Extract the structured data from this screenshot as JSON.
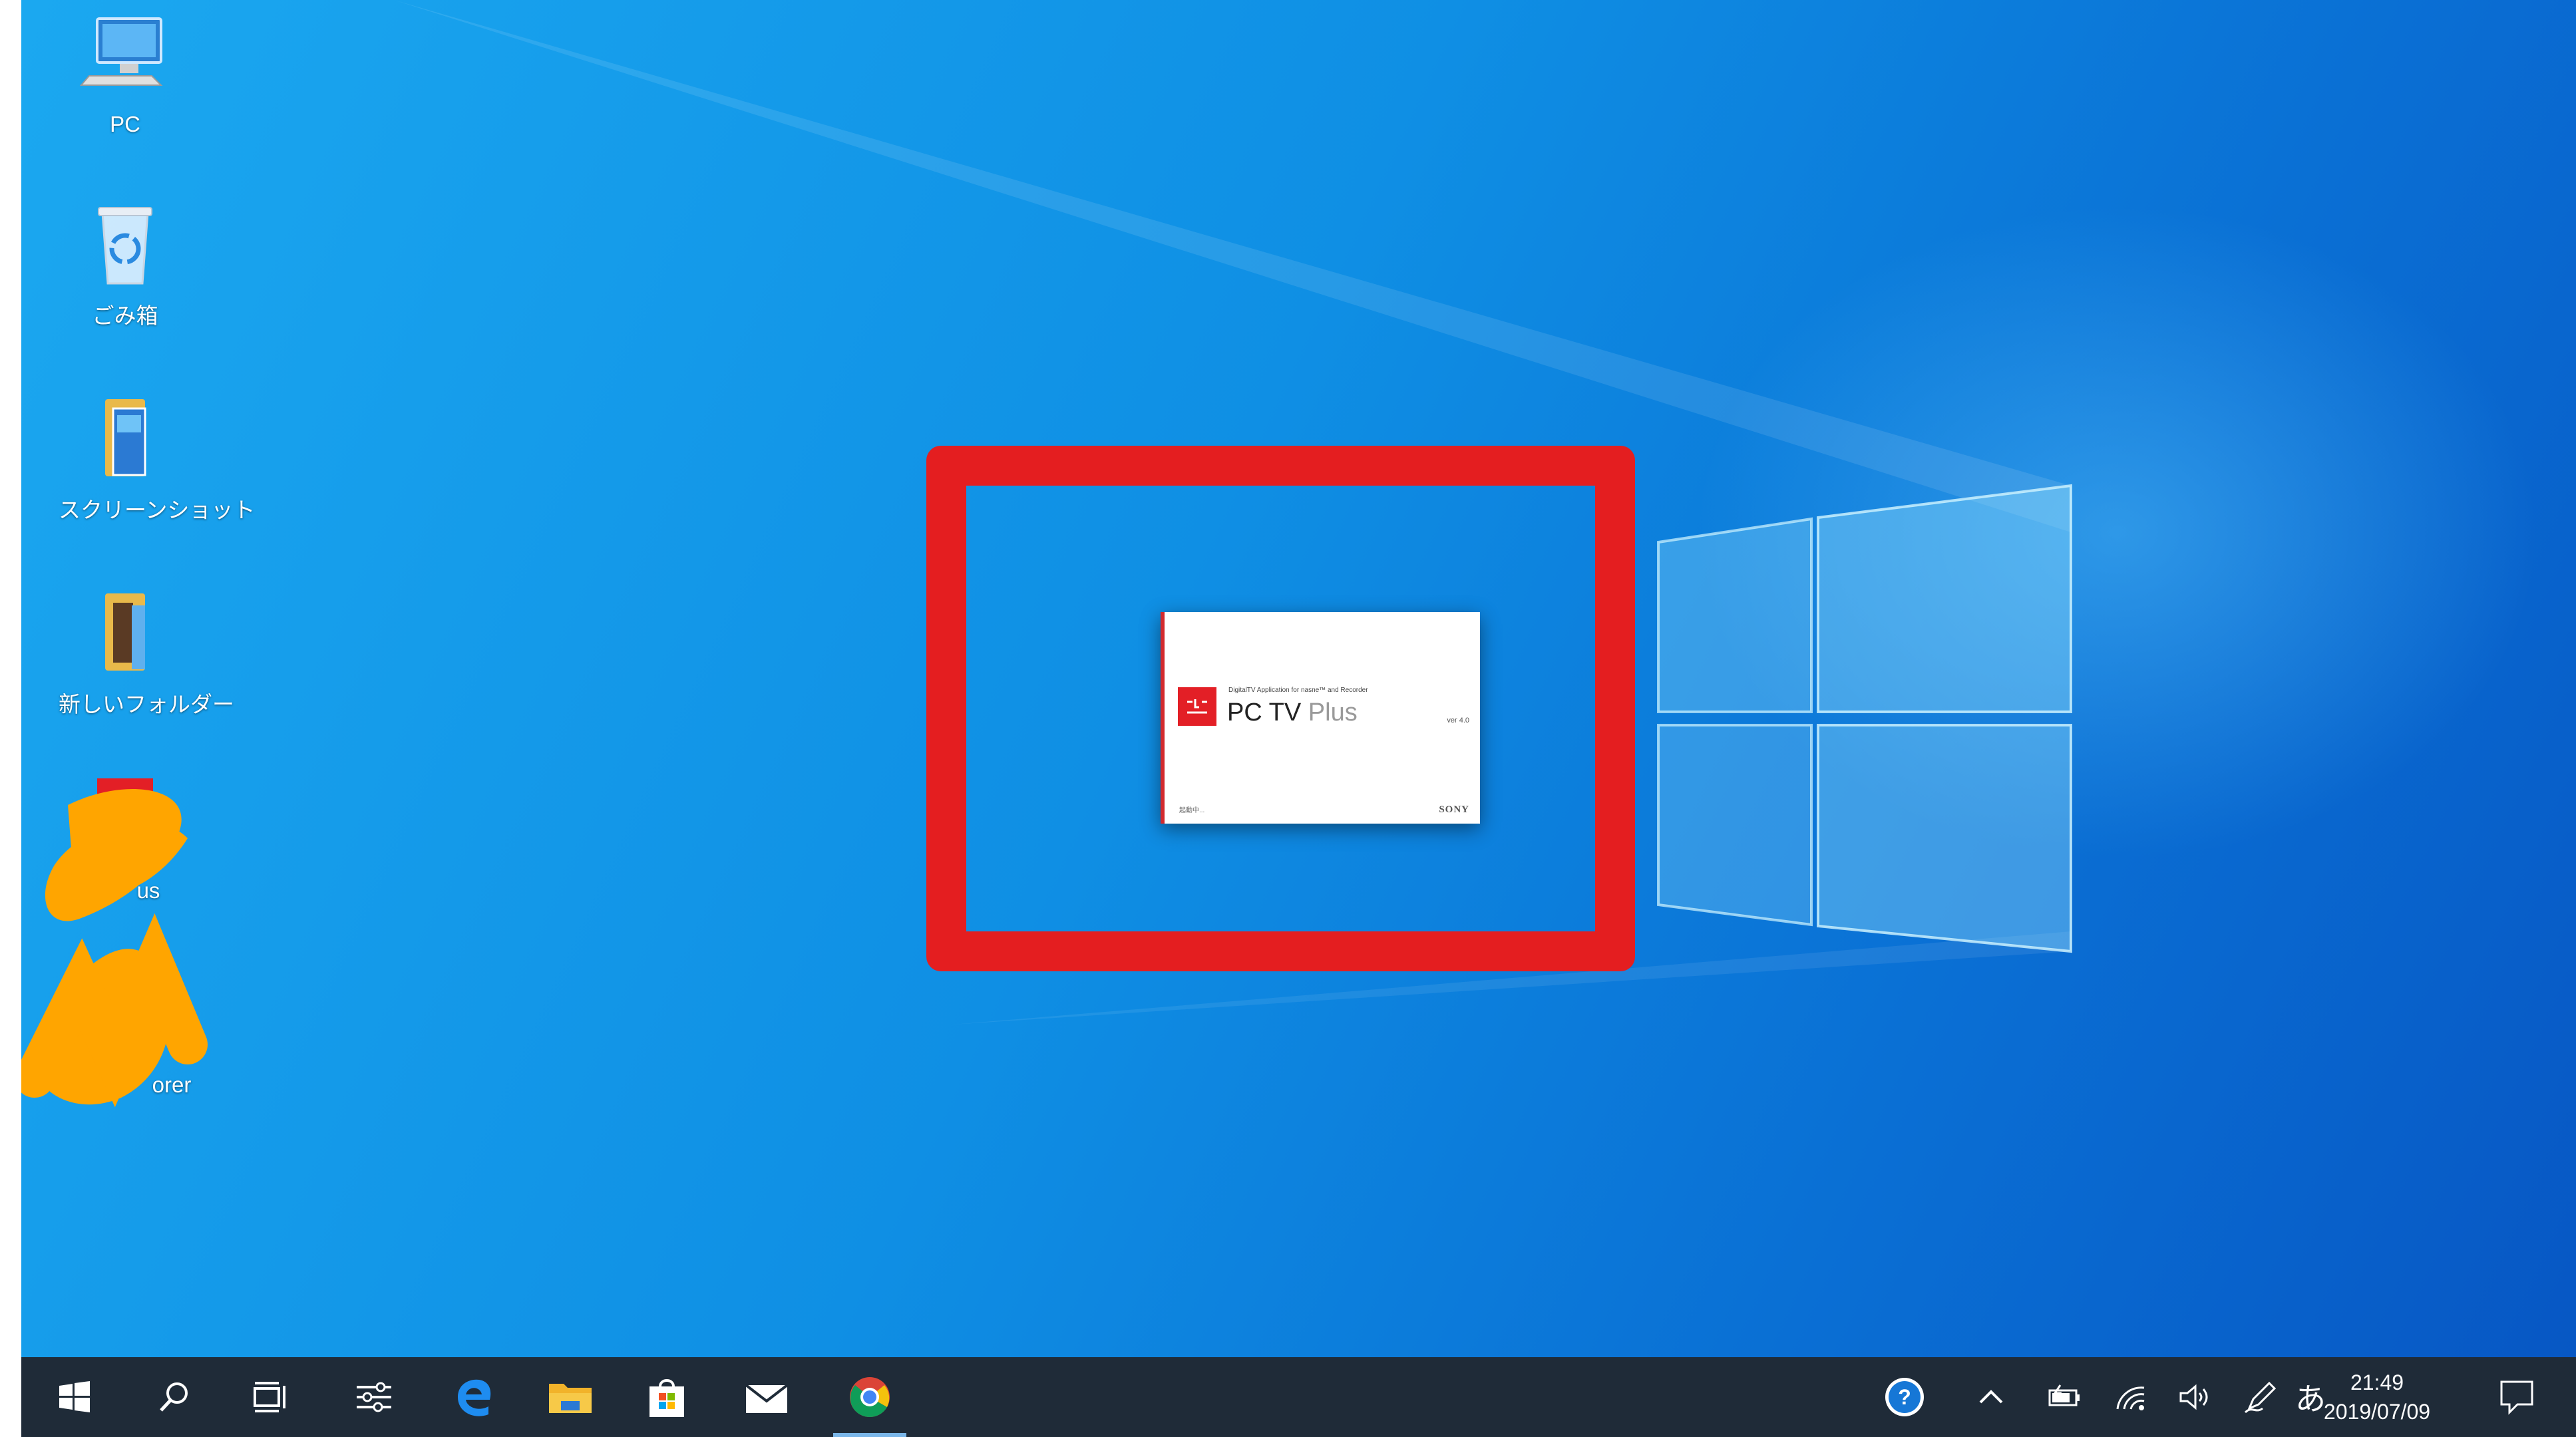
{
  "desktop": {
    "icons": [
      {
        "label": "PC",
        "icon": "computer-icon"
      },
      {
        "label": "ごみ箱",
        "icon": "recycle-bin-icon"
      },
      {
        "label": "スクリーンショット",
        "icon": "folder-icon"
      },
      {
        "label": "新しいフォルダー",
        "icon": "folder-icon"
      },
      {
        "label": "us",
        "icon": "app-icon"
      },
      {
        "label": "orer",
        "icon": "app-icon"
      }
    ]
  },
  "splash": {
    "tagline": "DigitalTV Application for nasne™ and Recorder",
    "title_main": "PC TV",
    "title_accent": " Plus",
    "version": "ver 4.0",
    "status": "起動中...",
    "brand": "SONY"
  },
  "taskbar": {
    "apps": [
      "start-icon",
      "search-icon",
      "task-view-icon",
      "settings-app-icon",
      "edge-icon",
      "file-explorer-icon",
      "store-icon",
      "mail-icon",
      "chrome-icon"
    ],
    "tray": [
      "help-icon",
      "chevron-up-icon",
      "battery-icon",
      "wifi-icon",
      "volume-icon",
      "pen-icon"
    ],
    "ime": "あ",
    "time": "21:49",
    "date": "2019/07/09"
  },
  "colors": {
    "highlight": "#e41e20",
    "scribble": "#ffa500",
    "taskbar": "#1f2b38"
  }
}
